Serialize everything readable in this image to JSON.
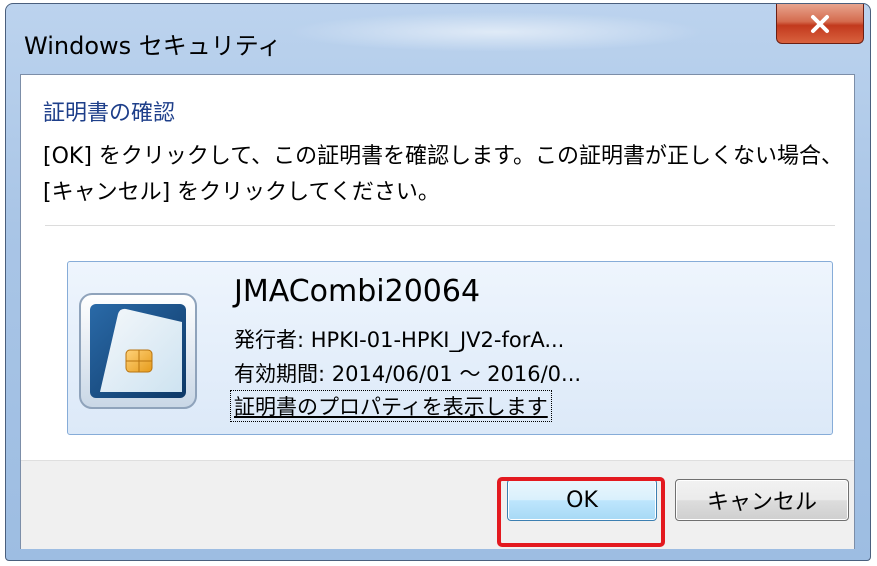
{
  "window": {
    "title": "Windows セキュリティ",
    "close_icon": "close-icon"
  },
  "dialog": {
    "heading": "証明書の確認",
    "message": "[OK] をクリックして、この証明書を確認します。この証明書が正しくない場合、[キャンセル] をクリックしてください。"
  },
  "certificate": {
    "icon": "smart-card-icon",
    "name": "JMACombi20064",
    "issuer": "発行者: HPKI-01-HPKI_JV2-forA...",
    "validity": "有効期間: 2014/06/01 ～ 2016/0...",
    "properties_link": "証明書のプロパティを表示します"
  },
  "buttons": {
    "ok": "OK",
    "cancel": "キャンセル"
  },
  "colors": {
    "heading": "#1e3f8a",
    "highlight": "#e3191f",
    "close_button": "#c2391d"
  }
}
